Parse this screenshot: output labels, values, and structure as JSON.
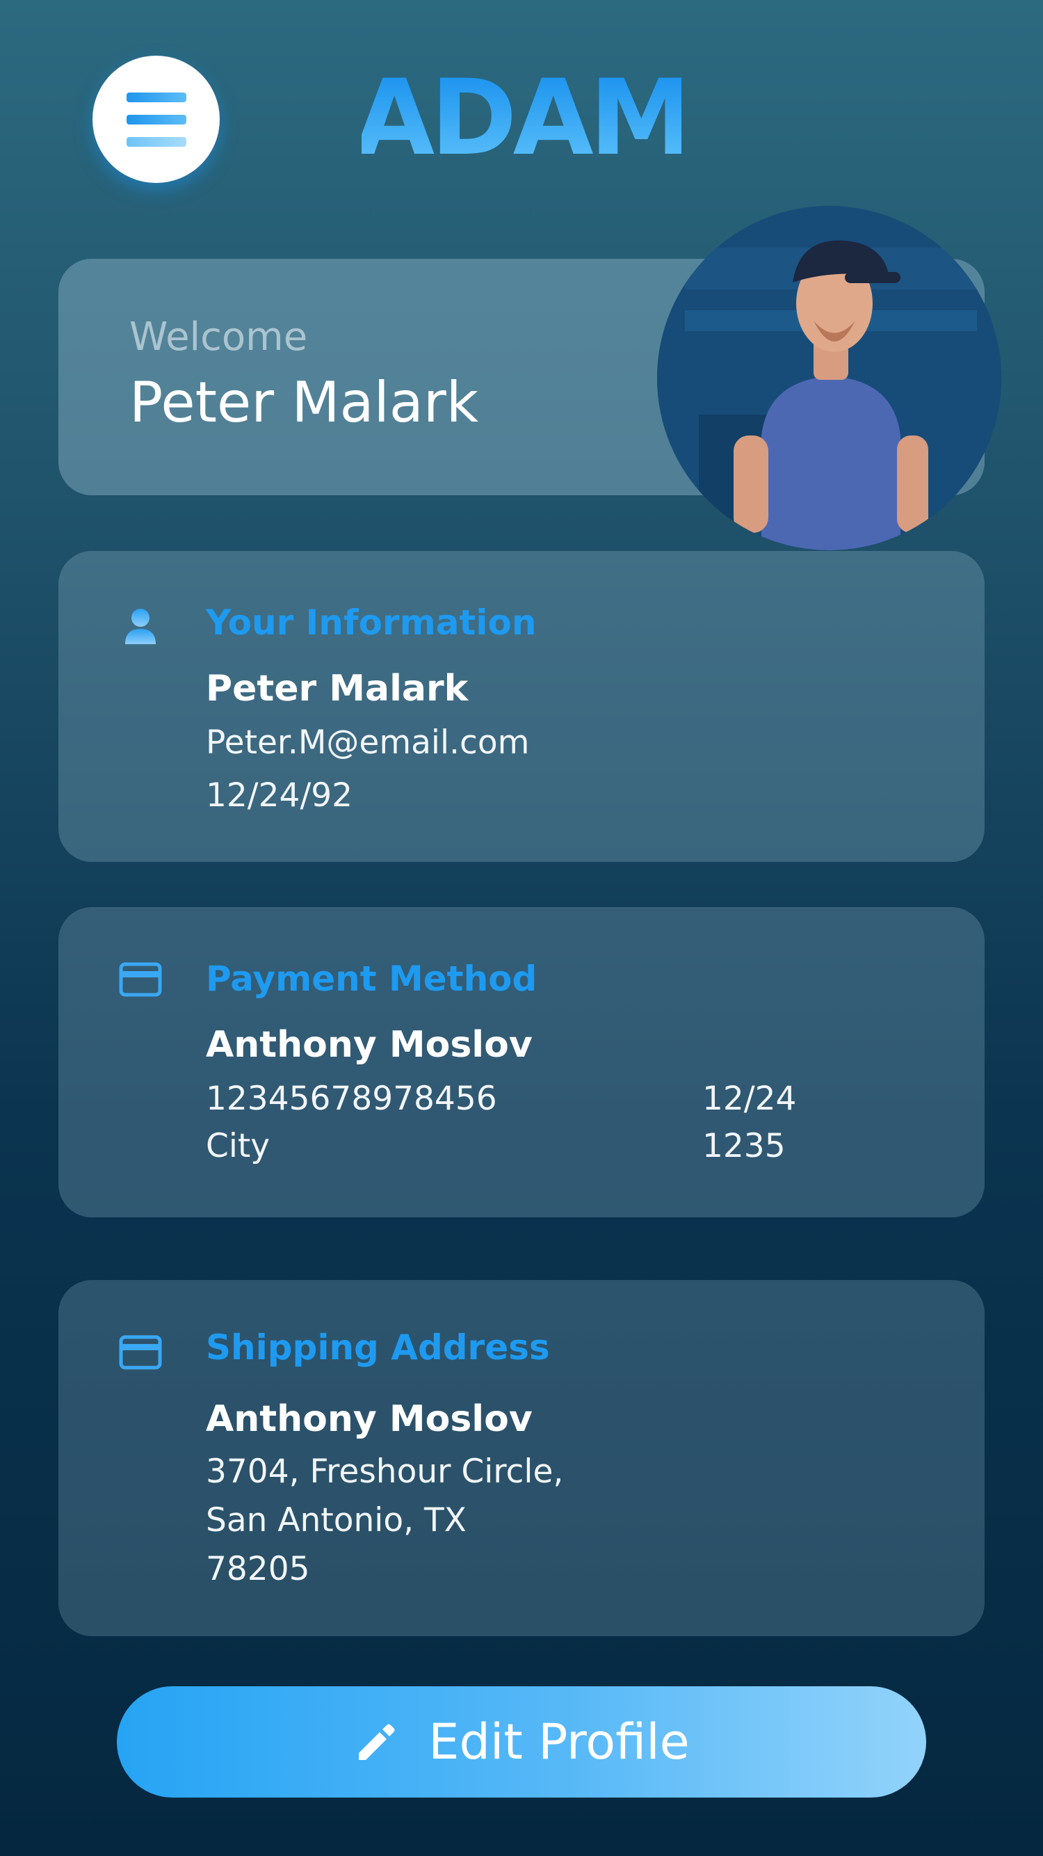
{
  "app": {
    "logo_text": "ADAM"
  },
  "welcome": {
    "label": "Welcome",
    "name": "Peter Malark"
  },
  "info": {
    "title": "Your Information",
    "name": "Peter Malark",
    "email": "Peter.M@email.com",
    "dob": "12/24/92"
  },
  "payment": {
    "title": "Payment Method",
    "name": "Anthony Moslov",
    "card_number": "12345678978456",
    "expiry": "12/24",
    "city": "City",
    "code": "1235"
  },
  "shipping": {
    "title": "Shipping Address",
    "name": "Anthony Moslov",
    "line1": "3704, Freshour Circle,",
    "line2": "San Antonio, TX",
    "zip": "78205"
  },
  "actions": {
    "edit_label": "Edit Profile"
  },
  "colors": {
    "accent": "#1e9af0",
    "button_start": "#26a4f4",
    "button_end": "#92d3fb"
  },
  "icons": {
    "menu": "hamburger-menu-icon",
    "info": "user-icon",
    "payment": "credit-card-icon",
    "shipping": "credit-card-icon",
    "edit": "pencil-icon"
  }
}
